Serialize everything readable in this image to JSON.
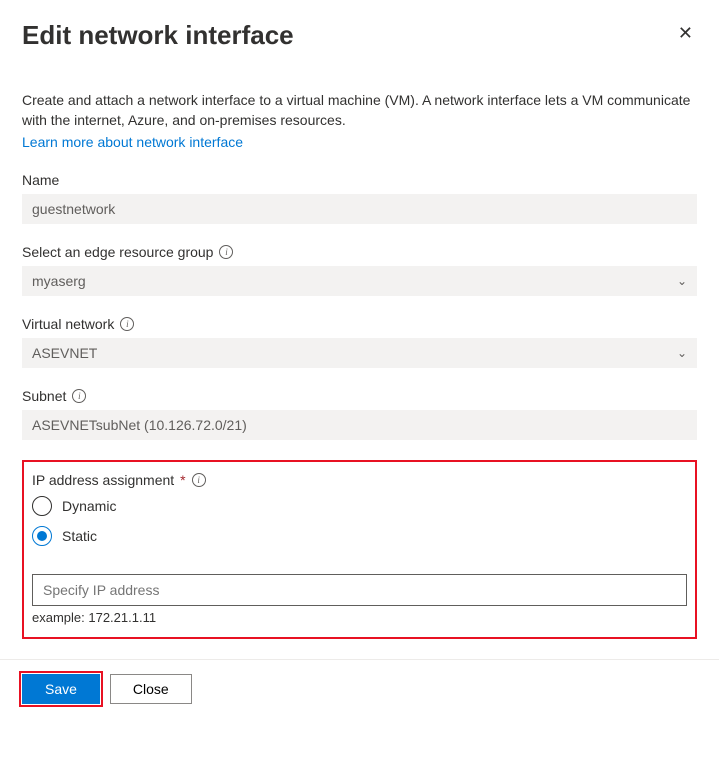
{
  "header": {
    "title": "Edit network interface"
  },
  "intro": {
    "description": "Create and attach a network interface to a virtual machine (VM). A network interface lets a VM communicate with the internet, Azure, and on-premises resources.",
    "link_text": "Learn more about network interface"
  },
  "fields": {
    "name": {
      "label": "Name",
      "value": "guestnetwork"
    },
    "resource_group": {
      "label": "Select an edge resource group",
      "value": "myaserg"
    },
    "vnet": {
      "label": "Virtual network",
      "value": "ASEVNET"
    },
    "subnet": {
      "label": "Subnet",
      "value": "ASEVNETsubNet (10.126.72.0/21)"
    },
    "ip_assignment": {
      "label": "IP address assignment",
      "options": {
        "dynamic": "Dynamic",
        "static": "Static"
      },
      "ip_placeholder": "Specify IP address",
      "example": "example: 172.21.1.11"
    }
  },
  "footer": {
    "save": "Save",
    "close": "Close"
  }
}
